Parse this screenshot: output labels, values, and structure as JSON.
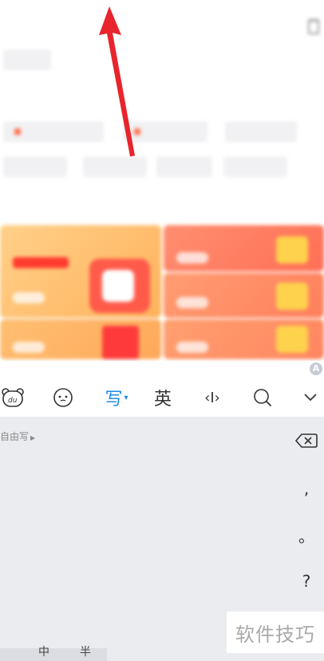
{
  "background": {
    "section_recent": "",
    "section_hot": "",
    "section_promo": "",
    "chips_recent": [
      ""
    ],
    "chips_hot": [
      "",
      "",
      "",
      "",
      "",
      "",
      ""
    ],
    "promo_titles": [
      "",
      "",
      "",
      "",
      ""
    ]
  },
  "toolbar": {
    "write_label": "写",
    "english_label": "英",
    "cursor_label": "‹I›",
    "items": [
      "du-bear-icon",
      "emoji-icon",
      "write-mode",
      "english-mode",
      "cursor-move-icon",
      "search-icon",
      "collapse-chevron-icon"
    ]
  },
  "handwriting": {
    "mode_label": "自由写",
    "side_keys": [
      ",",
      "。",
      "?"
    ]
  },
  "bottom_row": {
    "labels": [
      "中",
      "半"
    ]
  },
  "watermark": "软件技巧",
  "colors": {
    "accent": "#1e88e5",
    "arrow": "#e8242c",
    "panel": "#ebecf0"
  }
}
